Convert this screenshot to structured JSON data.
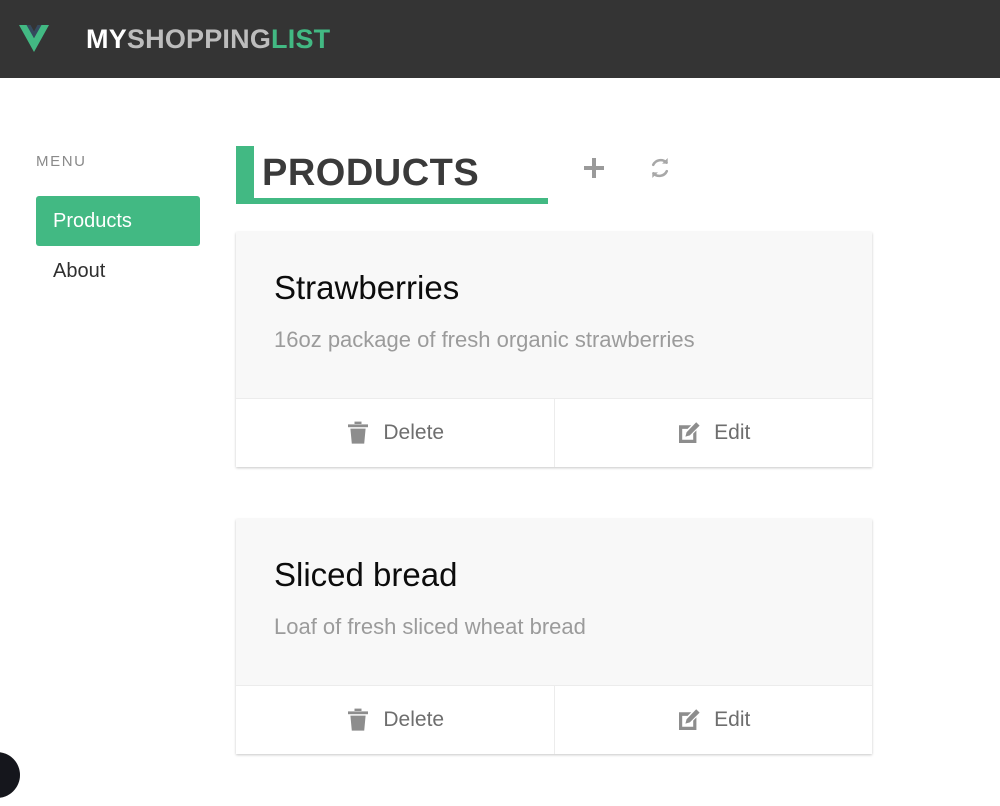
{
  "header": {
    "logo_icon": "vue-logo-icon",
    "brand": {
      "part1": "MY",
      "part2": "SHOPPING",
      "part3": "LIST"
    }
  },
  "sidebar": {
    "label": "MENU",
    "items": [
      {
        "label": "Products",
        "active": true
      },
      {
        "label": "About",
        "active": false
      }
    ]
  },
  "main": {
    "page_title": "PRODUCTS",
    "actions": [
      {
        "name": "add-product-button",
        "icon": "plus-icon"
      },
      {
        "name": "refresh-button",
        "icon": "refresh-icon"
      }
    ],
    "products": [
      {
        "title": "Strawberries",
        "description": "16oz package of fresh organic strawberries",
        "delete_label": "Delete",
        "edit_label": "Edit",
        "delete_icon": "trash-icon",
        "edit_icon": "pen-to-square-icon"
      },
      {
        "title": "Sliced bread",
        "description": "Loaf of fresh sliced wheat bread",
        "delete_label": "Delete",
        "edit_label": "Edit",
        "delete_icon": "trash-icon",
        "edit_icon": "pen-to-square-icon"
      }
    ]
  },
  "colors": {
    "accent_green": "#42b983",
    "topbar_dark": "#343434",
    "card_bg": "#f8f8f8",
    "muted_text": "#9b9b9b"
  }
}
